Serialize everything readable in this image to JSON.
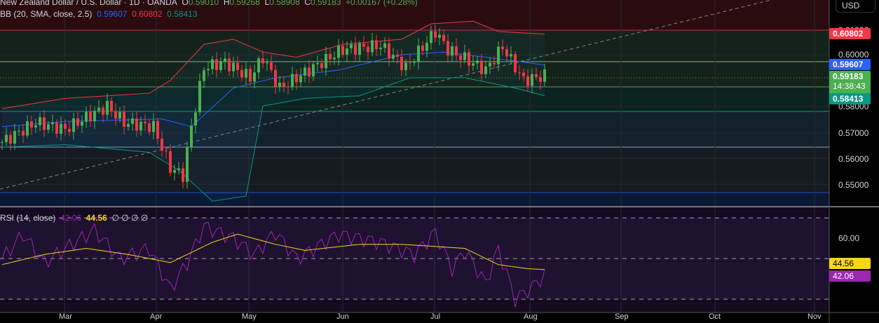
{
  "header": {
    "symbol": "New Zealand Dollar / U.S. Dollar · 1D · OANDA",
    "o_label": "O",
    "o": "0.59010",
    "h_label": "H",
    "h": "0.59268",
    "l_label": "L",
    "l": "0.58908",
    "c_label": "C",
    "c": "0.59183",
    "change": "+0.00167 (+0.28%)"
  },
  "bb": {
    "label": "BB (20, SMA, close, 2.5)",
    "basis": "0.59607",
    "upper": "0.60802",
    "lower": "0.58413"
  },
  "rsi": {
    "label": "RSI (14, close)",
    "value": "42.06",
    "ma": "44.56",
    "extras": [
      "∅",
      "∅",
      "∅",
      "∅"
    ]
  },
  "price_axis": {
    "currency": "USD",
    "ticks": [
      "0.61000",
      "0.60000",
      "0.58000",
      "0.57000",
      "0.56000",
      "0.55000"
    ],
    "tags": {
      "upper": "0.60802",
      "basis": "0.59607",
      "last": "0.59183",
      "countdown": "14:38:43",
      "lower": "0.58413"
    }
  },
  "rsi_axis": {
    "ticks": [
      "60.00"
    ],
    "tags": {
      "ma": "44.56",
      "rsi": "42.06"
    }
  },
  "time_axis": [
    "Mar",
    "Apr",
    "May",
    "Jun",
    "Jul",
    "Aug",
    "Sep",
    "Oct",
    "Nov"
  ],
  "colors": {
    "up": "#4caf50",
    "down": "#f23645",
    "basis": "#2962ff",
    "upper": "#f23645",
    "lower": "#089981",
    "rsi": "#9c27b0",
    "rsi_ma": "#f7d51d"
  },
  "chart_data": {
    "type": "candlestick",
    "price_range": [
      0.543,
      0.622
    ],
    "close_path": [
      [
        0,
        0.566
      ],
      [
        8,
        0.5736
      ],
      [
        15,
        0.571
      ],
      [
        25,
        0.58
      ],
      [
        29,
        0.5736
      ],
      [
        36,
        0.572
      ],
      [
        40,
        0.556
      ],
      [
        43,
        0.553
      ],
      [
        45,
        0.572
      ],
      [
        48,
        0.595
      ],
      [
        53,
        0.597
      ],
      [
        59,
        0.591
      ],
      [
        62,
        0.599
      ],
      [
        66,
        0.587
      ],
      [
        73,
        0.594
      ],
      [
        81,
        0.602
      ],
      [
        90,
        0.6035
      ],
      [
        96,
        0.595
      ],
      [
        103,
        0.609
      ],
      [
        106,
        0.602
      ],
      [
        115,
        0.594
      ],
      [
        119,
        0.603
      ],
      [
        124,
        0.59
      ],
      [
        129,
        0.5918
      ]
    ],
    "bb_upper": [
      [
        0,
        0.579
      ],
      [
        15,
        0.583
      ],
      [
        35,
        0.585
      ],
      [
        40,
        0.59
      ],
      [
        48,
        0.604
      ],
      [
        55,
        0.606
      ],
      [
        62,
        0.601
      ],
      [
        70,
        0.599
      ],
      [
        81,
        0.604
      ],
      [
        95,
        0.606
      ],
      [
        102,
        0.612
      ],
      [
        112,
        0.613
      ],
      [
        118,
        0.609
      ],
      [
        129,
        0.608
      ]
    ],
    "bb_basis": [
      [
        0,
        0.572
      ],
      [
        15,
        0.574
      ],
      [
        38,
        0.575
      ],
      [
        45,
        0.572
      ],
      [
        55,
        0.587
      ],
      [
        65,
        0.591
      ],
      [
        80,
        0.594
      ],
      [
        95,
        0.6
      ],
      [
        105,
        0.601
      ],
      [
        115,
        0.599
      ],
      [
        129,
        0.596
      ]
    ],
    "bb_lower": [
      [
        0,
        0.564
      ],
      [
        15,
        0.565
      ],
      [
        35,
        0.562
      ],
      [
        42,
        0.555
      ],
      [
        50,
        0.543
      ],
      [
        58,
        0.545
      ],
      [
        62,
        0.58
      ],
      [
        72,
        0.583
      ],
      [
        85,
        0.584
      ],
      [
        97,
        0.591
      ],
      [
        110,
        0.591
      ],
      [
        122,
        0.587
      ],
      [
        129,
        0.584
      ]
    ],
    "rsi_path": [
      [
        0,
        50
      ],
      [
        5,
        62
      ],
      [
        10,
        48
      ],
      [
        15,
        55
      ],
      [
        22,
        64
      ],
      [
        28,
        50
      ],
      [
        35,
        55
      ],
      [
        40,
        35
      ],
      [
        44,
        48
      ],
      [
        48,
        66
      ],
      [
        55,
        60
      ],
      [
        60,
        52
      ],
      [
        65,
        63
      ],
      [
        70,
        50
      ],
      [
        80,
        62
      ],
      [
        90,
        58
      ],
      [
        98,
        52
      ],
      [
        103,
        63
      ],
      [
        107,
        45
      ],
      [
        110,
        54
      ],
      [
        115,
        38
      ],
      [
        118,
        55
      ],
      [
        122,
        30
      ],
      [
        126,
        36
      ],
      [
        129,
        42
      ]
    ],
    "rsi_ma_path": [
      [
        0,
        47
      ],
      [
        10,
        52
      ],
      [
        20,
        55
      ],
      [
        30,
        52
      ],
      [
        40,
        48
      ],
      [
        50,
        58
      ],
      [
        56,
        62
      ],
      [
        65,
        57
      ],
      [
        72,
        54
      ],
      [
        85,
        57
      ],
      [
        95,
        57
      ],
      [
        110,
        55
      ],
      [
        118,
        47
      ],
      [
        125,
        45
      ],
      [
        129,
        44.56
      ]
    ],
    "rsi_levels": [
      70,
      50,
      30
    ]
  }
}
